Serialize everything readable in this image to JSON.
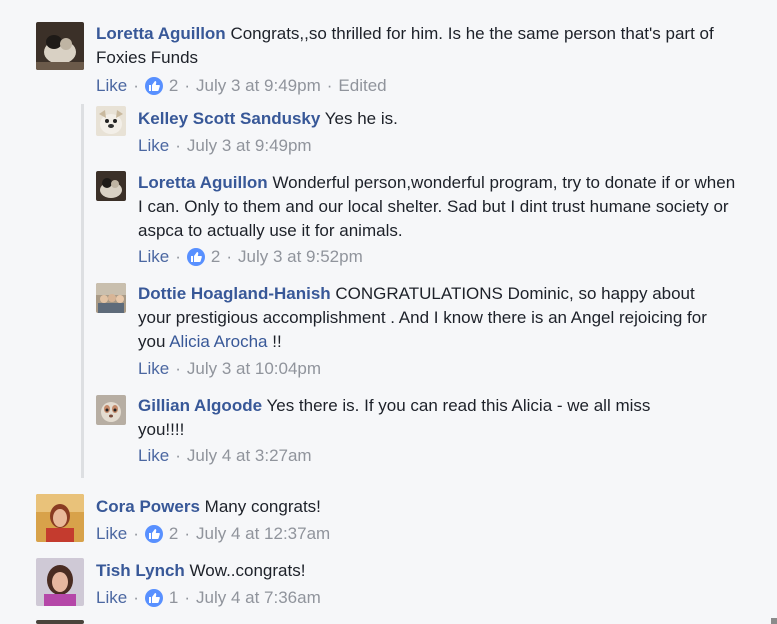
{
  "comments": [
    {
      "author": "Loretta Aguillon",
      "text": "Congrats,,so thrilled for him. Is he the same person that's part of Foxies Funds",
      "like_label": "Like",
      "reaction_count": "2",
      "timestamp": "July 3 at 9:49pm",
      "edited": "Edited"
    },
    {
      "author": "Kelley Scott Sandusky",
      "text": "Yes he is.",
      "like_label": "Like",
      "timestamp": "July 3 at 9:49pm"
    },
    {
      "author": "Loretta Aguillon",
      "text": "Wonderful person,wonderful program, try to donate if or when I can. Only to them and our local shelter. Sad but I dint trust humane society or aspca to actually use it for animals.",
      "like_label": "Like",
      "reaction_count": "2",
      "timestamp": "July 3 at 9:52pm"
    },
    {
      "author": "Dottie Hoagland-Hanish",
      "text": "CONGRATULATIONS Dominic, so happy about your prestigious accomplishment . And I know there is an Angel rejoicing for you",
      "mention": "Alicia Arocha",
      "text_after": "!!",
      "like_label": "Like",
      "timestamp": "July 3 at 10:04pm"
    },
    {
      "author": "Gillian Algoode",
      "text": "Yes there is. If you can read this Alicia - we all miss you!!!!",
      "like_label": "Like",
      "timestamp": "July 4 at 3:27am"
    },
    {
      "author": "Cora Powers",
      "text": "Many congrats!",
      "like_label": "Like",
      "reaction_count": "2",
      "timestamp": "July 4 at 12:37am"
    },
    {
      "author": "Tish Lynch",
      "text": "Wow..congrats!",
      "like_label": "Like",
      "reaction_count": "1",
      "timestamp": "July 4 at 7:36am"
    }
  ],
  "colors": {
    "background": "#f6f7f9",
    "author": "#385898",
    "meta": "#90949c",
    "like_icon": "#5890ff"
  }
}
